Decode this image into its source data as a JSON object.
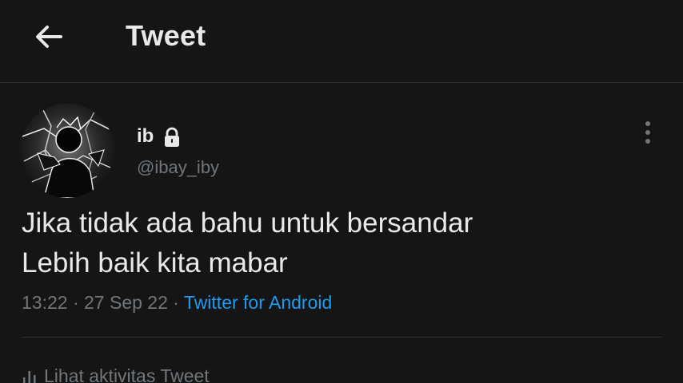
{
  "header": {
    "title": "Tweet",
    "back_icon": "arrow-left-icon"
  },
  "tweet": {
    "author": {
      "display_name": "ib",
      "username": "@ibay_iby",
      "protected_icon": "lock-icon",
      "avatar_icon": "profile-avatar-icon"
    },
    "text_lines": [
      "Jika tidak ada bahu untuk bersandar",
      "Lebih baik kita mabar"
    ],
    "time": "13:22",
    "date": "27 Sep 22",
    "separator": " · ",
    "source": "Twitter for Android",
    "more_icon": "more-vertical-icon"
  },
  "activity": {
    "label": "Lihat aktivitas Tweet",
    "icon": "analytics-bar-icon"
  },
  "colors": {
    "background": "#151515",
    "primary_text": "#e7e9ea",
    "secondary_text": "#71767b",
    "link": "#1d9bf0",
    "divider": "#2f3336"
  }
}
